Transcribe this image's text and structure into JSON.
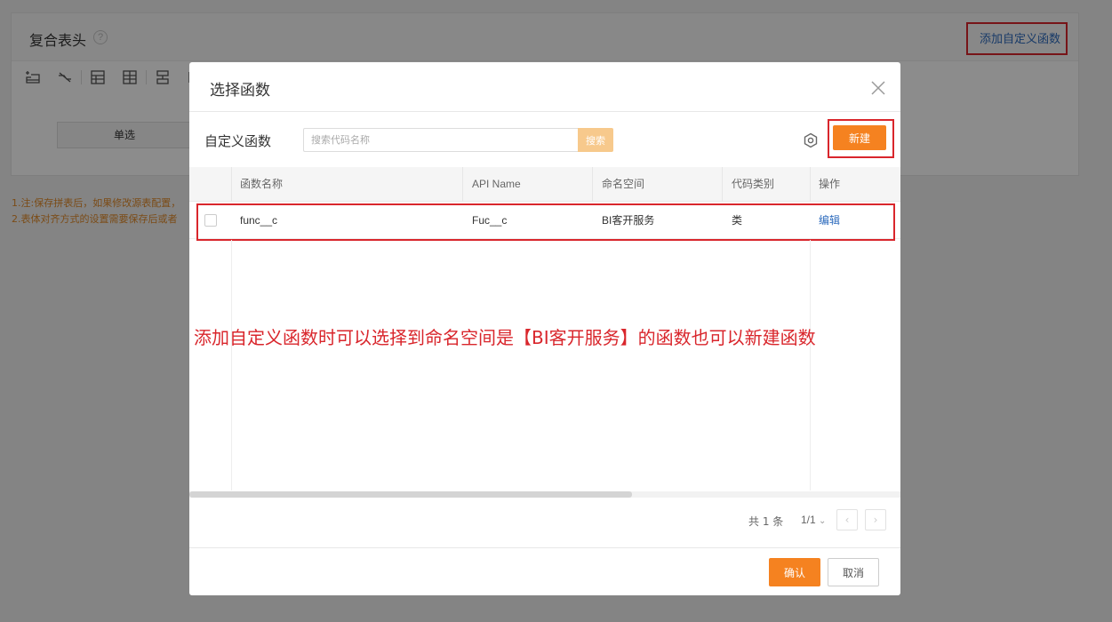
{
  "background": {
    "panel_title": "复合表头",
    "help_icon": "?",
    "add_custom_function_link": "添加自定义函数",
    "single_select_label": "单选",
    "notes": [
      "1.注:保存拼表后，如果修改源表配置，",
      "2.表体对齐方式的设置需要保存后或者"
    ],
    "toolbar_icons": [
      "insert-row-icon",
      "unlink-icon",
      "merge-cells-icon",
      "table-grid-icon",
      "split-row-icon",
      "column-resize-icon"
    ]
  },
  "modal": {
    "title": "选择函数",
    "close_icon": "close-icon",
    "custom_function_label": "自定义函数",
    "search": {
      "placeholder": "搜索代码名称",
      "button_label": "搜索"
    },
    "settings_icon": "settings-icon",
    "new_button_label": "新建",
    "table": {
      "columns": [
        "函数名称",
        "API Name",
        "命名空间",
        "代码类别",
        "操作"
      ],
      "rows": [
        {
          "name": "func__c",
          "api_name": "Fuc__c",
          "namespace": "BI客开服务",
          "category": "类",
          "action": "编辑"
        }
      ]
    },
    "annotation": "添加自定义函数时可以选择到命名空间是【BI客开服务】的函数也可以新建函数",
    "pager": {
      "total": "共 1 条",
      "page": "1/1",
      "prev": "‹",
      "next": "›"
    },
    "footer": {
      "confirm_label": "确认",
      "cancel_label": "取消"
    }
  },
  "colors": {
    "accent_orange": "#f58220",
    "annotation_red": "#d9262c",
    "link_blue": "#2d6bbd"
  }
}
